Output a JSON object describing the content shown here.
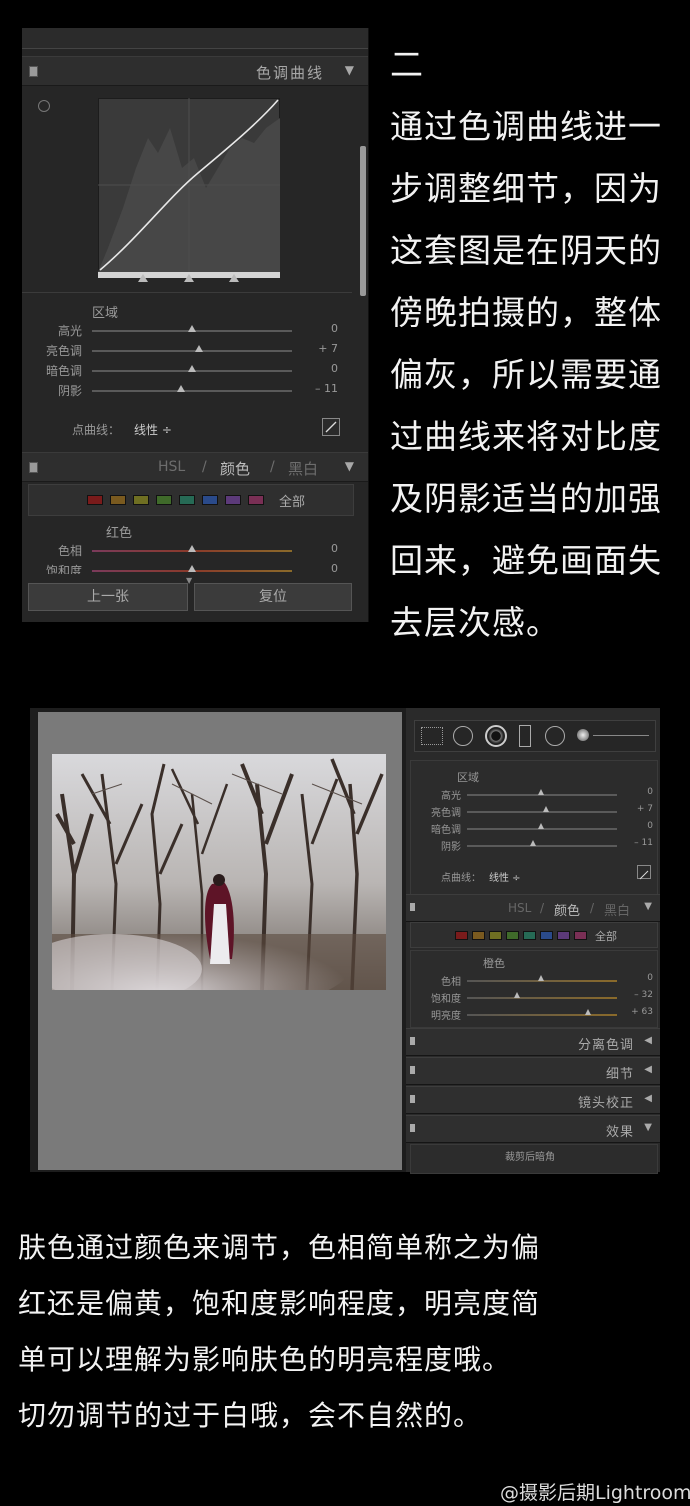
{
  "panel_top": {
    "tone_curve_header": "色调曲线",
    "region_label": "区域",
    "sliders": [
      {
        "label": "高光",
        "value": "0",
        "pos": 0.5
      },
      {
        "label": "亮色调",
        "value": "+ 7",
        "pos": 0.535
      },
      {
        "label": "暗色调",
        "value": "0",
        "pos": 0.5
      },
      {
        "label": "阴影",
        "value": "– 11",
        "pos": 0.445
      }
    ],
    "point_curve_label": "点曲线：",
    "point_curve_value": "线性 ÷",
    "hsl_tabs": {
      "hsl": "HSL",
      "sep1": "/",
      "color": "颜色",
      "sep2": "/",
      "bw": "黑白"
    },
    "swatch_all": "全部",
    "swatch_colors": [
      "#7a1b1b",
      "#7a5a1f",
      "#6f6f22",
      "#3f6a2a",
      "#266a55",
      "#2a4a8a",
      "#5c3a7a",
      "#7a2f55"
    ],
    "color_title": "红色",
    "color_sliders": [
      {
        "label": "色相",
        "value": "0",
        "pos": 0.5
      },
      {
        "label": "饱和度",
        "value": "0",
        "pos": 0.5
      }
    ],
    "prev_button": "上一张",
    "reset_button": "复位"
  },
  "right_paragraph": {
    "heading": "二",
    "lines": [
      "通过色调曲线进一",
      "步调整细节，因为",
      "这套图是在阴天的",
      "傍晚拍摄的，整体",
      "偏灰，所以需要通",
      "过曲线来将对比度",
      "及阴影适当的加强",
      "回来，避免画面失",
      "去层次感。"
    ]
  },
  "panel_second": {
    "region_label": "区域",
    "sliders": [
      {
        "label": "高光",
        "value": "0",
        "pos": 0.5
      },
      {
        "label": "亮色调",
        "value": "+ 7",
        "pos": 0.535
      },
      {
        "label": "暗色调",
        "value": "0",
        "pos": 0.5
      },
      {
        "label": "阴影",
        "value": "– 11",
        "pos": 0.445
      }
    ],
    "point_curve_label": "点曲线：",
    "point_curve_value": "线性 ÷",
    "hsl_tabs": {
      "hsl": "HSL",
      "sep1": "/",
      "color": "颜色",
      "sep2": "/",
      "bw": "黑白"
    },
    "swatch_all": "全部",
    "color_title": "橙色",
    "color_sliders": [
      {
        "label": "色相",
        "value": "0",
        "pos": 0.5
      },
      {
        "label": "饱和度",
        "value": "– 32",
        "pos": 0.34
      },
      {
        "label": "明亮度",
        "value": "+ 63",
        "pos": 0.815
      }
    ],
    "sections": [
      "分离色调",
      "细节",
      "镜头校正",
      "效果"
    ],
    "vignette_label": "裁剪后暗角"
  },
  "bottom_paragraph": {
    "lines": [
      "肤色通过颜色来调节，色相简单称之为偏",
      "红还是偏黄，饱和度影响程度，明亮度简",
      "单可以理解为影响肤色的明亮程度哦。",
      "切勿调节的过于白哦，会不自然的。"
    ]
  },
  "watermark": "@摄影后期Lightroom"
}
